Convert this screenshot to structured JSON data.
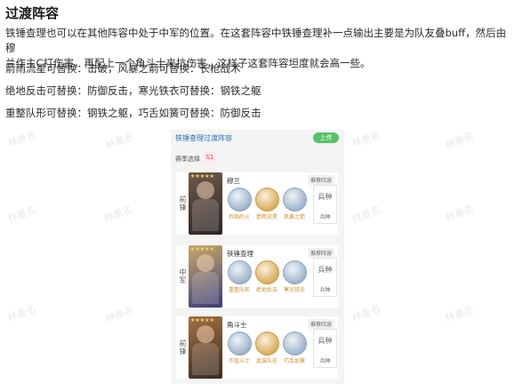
{
  "watermark_text": "林墨名",
  "section_title": "过渡阵容",
  "paragraphs": [
    "铁锤查理也可以在其他阵容中处于中军的位置。在这套阵容中铁锤查理补一点输出主要是为队友叠buff，然后由穆",
    "兰作主C打伤害，再配上一个角斗士来抗伤害，这样子这套阵容坦度就会高一些。",
    "箭雨流星可替换：击破，风暴之箭可替换：长枪战术",
    "绝地反击可替换：防御反击，寒光铁衣可替换：钢铁之躯",
    "重整队形可替换：钢铁之躯，巧舌如簧可替换：防御反击"
  ],
  "card": {
    "title": "铁锤查理过渡阵容",
    "upload_button": "上传",
    "season_label": "赛季选择",
    "season_value": "S1",
    "rows": [
      {
        "role": "前锋",
        "hero": "穆兰",
        "recommend_tag": "推荐阵容",
        "skills": [
          "烈焰的火",
          "箭雨流星",
          "风暴之箭"
        ],
        "troop_icon": "兵种",
        "troop_label": "兵种",
        "portrait_colors": [
          "#6e5a4a",
          "#2b2523"
        ]
      },
      {
        "role": "中军",
        "hero": "铁锤查理",
        "recommend_tag": "推荐阵容",
        "skills": [
          "重整队形",
          "绝地反击",
          "寒光铁衣"
        ],
        "troop_icon": "兵种",
        "troop_label": "兵种",
        "portrait_colors": [
          "#c7a86a",
          "#3c3c78"
        ]
      },
      {
        "role": "前锋",
        "hero": "角斗士",
        "recommend_tag": "推荐阵容",
        "skills": [
          "不屈斗士",
          "武装队形",
          "巧舌如簧"
        ],
        "troop_icon": "兵种",
        "troop_label": "兵种",
        "portrait_colors": [
          "#a36f43",
          "#3a2a20"
        ]
      }
    ]
  },
  "colors": {
    "accent_green": "#58c26b",
    "skill_gold": "#c9902a",
    "link_blue": "#2a6fb0"
  }
}
